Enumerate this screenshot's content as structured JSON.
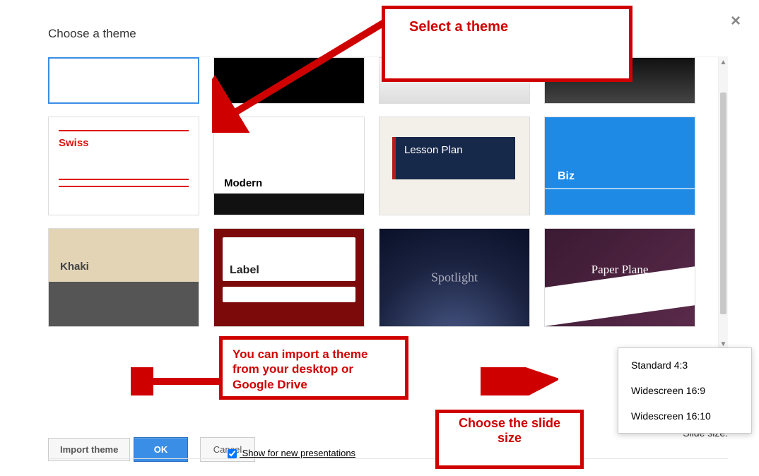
{
  "dialog": {
    "title": "Choose a theme",
    "close_tooltip": "Close"
  },
  "themes": {
    "row1": {
      "swiss": "Swiss",
      "modern": "Modern",
      "lesson": "Lesson Plan",
      "biz": "Biz"
    },
    "row2": {
      "khaki": "Khaki",
      "label": "Label",
      "spotlight": "Spotlight",
      "paper": "Paper Plane"
    }
  },
  "footer": {
    "import_label": "Import theme",
    "slide_size_label": "Slide size:",
    "show_for_new": "Show for new presentations",
    "ok": "OK",
    "cancel": "Cancel"
  },
  "size_menu": {
    "opt1": "Standard 4:3",
    "opt2": "Widescreen 16:9",
    "opt3": "Widescreen 16:10"
  },
  "annotations": {
    "select_theme": "Select a theme",
    "import_note": "You can import a theme from your desktop or Google Drive",
    "choose_size": "Choose the slide size"
  }
}
